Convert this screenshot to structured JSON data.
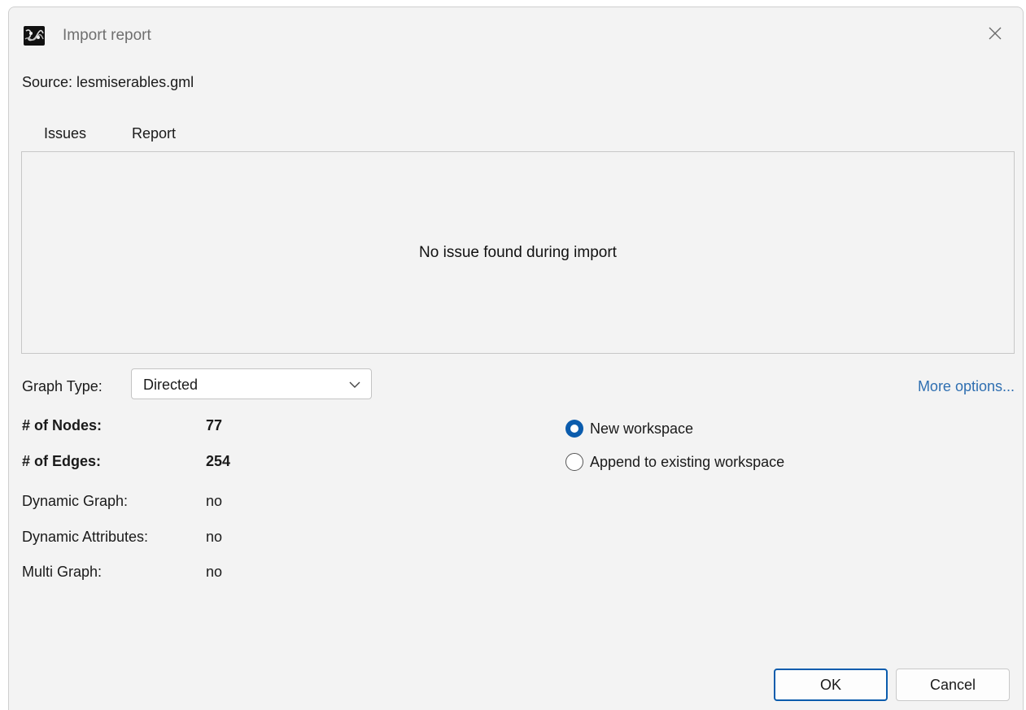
{
  "window": {
    "title": "Import report"
  },
  "source": {
    "label": "Source:  lesmiserables.gml"
  },
  "tabs": [
    {
      "label": "Issues",
      "active": true
    },
    {
      "label": "Report",
      "active": false
    }
  ],
  "panel": {
    "message": "No issue found during import"
  },
  "graph_type": {
    "label": "Graph Type:",
    "value": "Directed"
  },
  "more_options": "More options...",
  "stats": [
    {
      "label": "# of Nodes:",
      "value": "77"
    },
    {
      "label": "# of Edges:",
      "value": "254"
    },
    {
      "label": "Dynamic Graph:",
      "value": "no"
    },
    {
      "label": "Dynamic Attributes:",
      "value": "no"
    },
    {
      "label": "Multi Graph:",
      "value": "no"
    }
  ],
  "workspace_options": [
    {
      "label": "New workspace",
      "selected": true
    },
    {
      "label": "Append to existing workspace",
      "selected": false
    }
  ],
  "buttons": {
    "ok": "OK",
    "cancel": "Cancel"
  },
  "icons": {
    "app": "gephi-app-icon",
    "close": "close-icon",
    "dropdown": "chevron-down-icon"
  },
  "colors": {
    "accent": "#0b5cad",
    "link": "#2f6fb1",
    "background": "#f3f3f3"
  }
}
